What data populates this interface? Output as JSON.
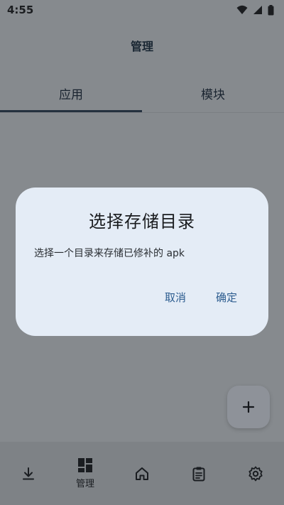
{
  "status_bar": {
    "time": "4:55"
  },
  "header": {
    "title": "管理"
  },
  "tabs": [
    {
      "label": "应用",
      "active": true
    },
    {
      "label": "模块",
      "active": false
    }
  ],
  "dialog": {
    "title": "选择存储目录",
    "message": "选择一个目录来存储已修补的 apk",
    "cancel_label": "取消",
    "confirm_label": "确定"
  },
  "fab": {
    "icon": "plus-icon"
  },
  "bottom_nav": {
    "items": [
      {
        "icon": "download-icon",
        "label": ""
      },
      {
        "icon": "dashboard-icon",
        "label": "管理",
        "active": true
      },
      {
        "icon": "home-icon",
        "label": ""
      },
      {
        "icon": "clipboard-icon",
        "label": ""
      },
      {
        "icon": "settings-icon",
        "label": ""
      }
    ]
  },
  "colors": {
    "scrim_background": "#868a8e",
    "dialog_background": "#e4ecf6",
    "accent": "#2c5c8f"
  }
}
